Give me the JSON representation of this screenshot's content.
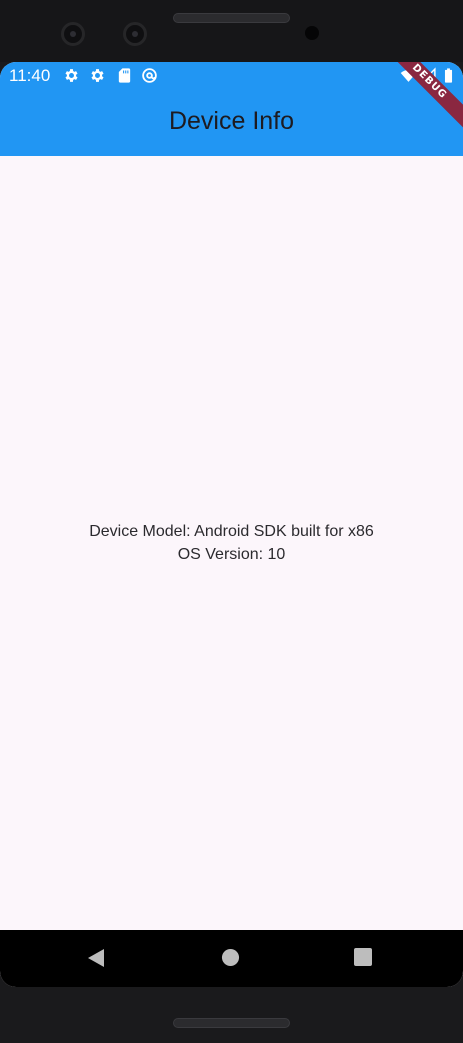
{
  "status_bar": {
    "time": "11:40",
    "icons": [
      "gear-icon",
      "gear-icon",
      "sd-card-icon",
      "at-sign-icon",
      "wifi-icon",
      "signal-icon",
      "battery-icon"
    ]
  },
  "app_bar": {
    "title": "Device Info",
    "color": "#2196f3"
  },
  "debug_banner": {
    "label": "DEBUG",
    "color": "#8a2740"
  },
  "body": {
    "device_model_text": "Device Model: Android SDK built for x86",
    "os_version_text": "OS Version: 10",
    "background": "#fcf6fb"
  },
  "nav_bar": {
    "buttons": [
      "back-icon",
      "home-icon",
      "recents-icon"
    ]
  }
}
